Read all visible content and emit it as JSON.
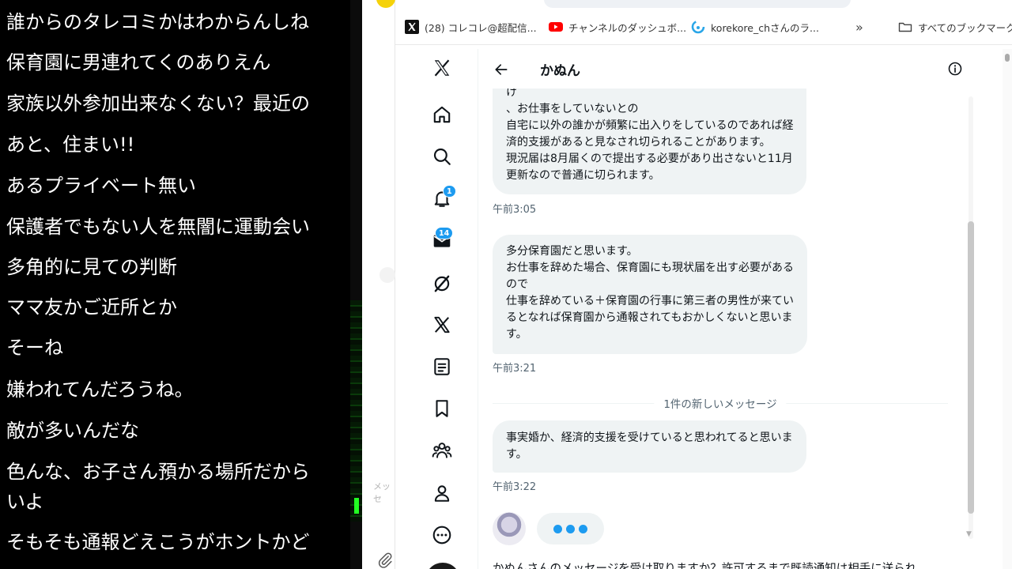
{
  "comments": [
    "誰からのタレコミかはわからんしね",
    "保育園に男連れてくのありえん",
    "家族以外参加出来なくない？最近の",
    "あと、住まい!!",
    "あるプライベート無い",
    "保護者でもない人を無闇に運動会い",
    "多角的に見ての判断",
    "ママ友かご近所とか",
    "そーね",
    "嫌われてんだろうね。",
    "敵が多いんだな",
    "色んな、お子さん預かる場所だから",
    "いよ",
    "そもそも通報どえこうがホントかど"
  ],
  "side_strip": {
    "message_stub": "メッセ"
  },
  "bookmarks": {
    "items": [
      {
        "label": "(28) コレコレ@超配信...",
        "icon": "x-logo-icon"
      },
      {
        "label": "チャンネルのダッシュボ...",
        "icon": "youtube-icon"
      },
      {
        "label": "korekore_chさんのラ...",
        "icon": "twitcasting-icon"
      }
    ],
    "overflow": "»",
    "all_bookmarks": "すべてのブックマーク"
  },
  "nav": {
    "notifications_badge": "1",
    "messages_badge": "14"
  },
  "dm": {
    "contact_name": "かぬん",
    "messages": [
      {
        "lines": [
          "け",
          "、お仕事をしていないとの",
          "自宅に以外の誰かが頻繁に出入りをしているのであれば経",
          "済的支援があると見なされ切られることがあります。",
          "現況届は8月届くので提出する必要があり出さないと11月",
          "更新なので普通に切られます。"
        ],
        "time": "午前3:05"
      },
      {
        "lines": [
          "多分保育園だと思います。",
          "お仕事を辞めた場合、保育園にも現状届を出す必要がある",
          "ので",
          "仕事を辞めている＋保育園の行事に第三者の男性が来てい",
          "るとなれば保育園から通報されてもおかしくないと思いま",
          "す。"
        ],
        "time": "午前3:21"
      },
      {
        "lines": [
          "事実婚か、経済的支援を受けていると思われてると思いま",
          "す。"
        ],
        "time": "午前3:22"
      }
    ],
    "new_messages_divider": "1件の新しいメッセージ",
    "request_prompt": "かぬんさんのメッセージを受け取りますか？許可するまで既読通知は相手に送られ"
  },
  "colors": {
    "accent": "#1d9bf0",
    "bubble_bg": "#eff3f4",
    "timestamp": "#536471",
    "comment_text": "#ffffff",
    "comment_bg": "#000000"
  }
}
